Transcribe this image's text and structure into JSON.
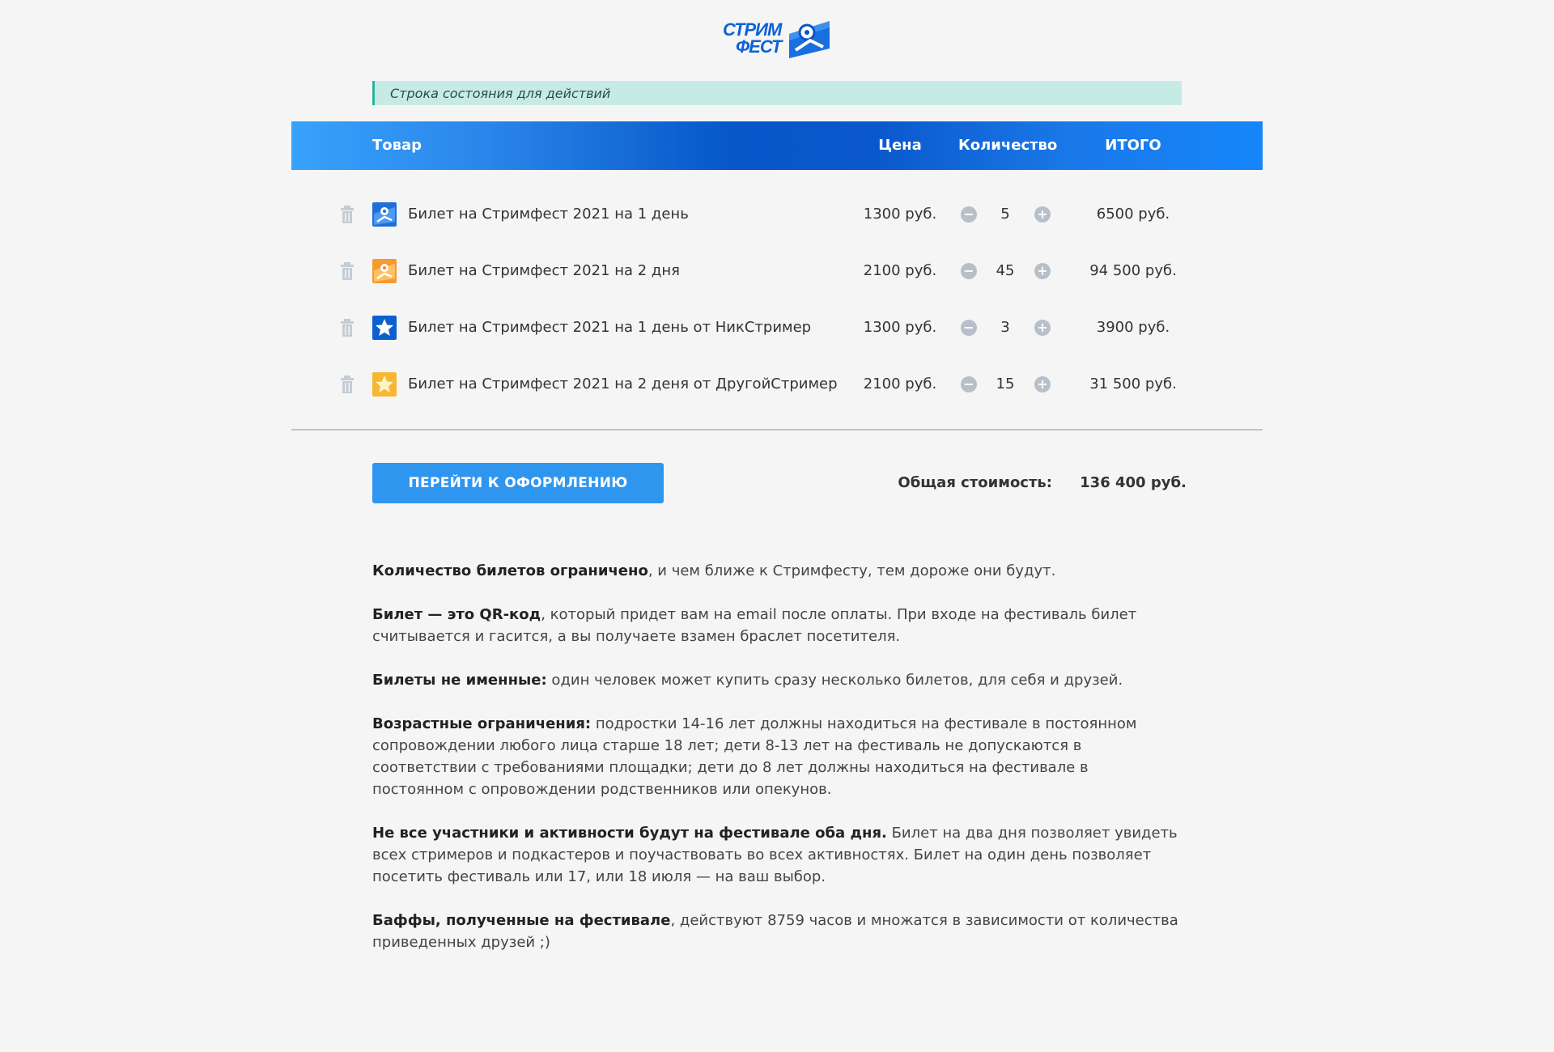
{
  "logo": {
    "line1": "СТРИМ",
    "line2": "ФЕСТ"
  },
  "status_bar": {
    "text": "Строка состояния для действий"
  },
  "table": {
    "headers": {
      "product": "Товар",
      "price": "Цена",
      "quantity": "Количество",
      "total": "ИТОГО"
    },
    "rows": [
      {
        "name": "Билет на Стримфест 2021 на 1 день",
        "price": "1300 руб.",
        "quantity": "5",
        "total": "6500 руб.",
        "icon": "blue-logo-ticket"
      },
      {
        "name": "Билет на Стримфест 2021 на 2 дня",
        "price": "2100 руб.",
        "quantity": "45",
        "total": "94 500 руб.",
        "icon": "orange-logo-ticket"
      },
      {
        "name": "Билет на Стримфест 2021 на 1 день от НикСтример",
        "price": "1300 руб.",
        "quantity": "3",
        "total": "3900 руб.",
        "icon": "blue-star"
      },
      {
        "name": "Билет на Стримфест 2021 на 2 деня от ДругойСтример",
        "price": "2100 руб.",
        "quantity": "15",
        "total": "31 500 руб.",
        "icon": "yellow-star"
      }
    ],
    "minus_icon": "minus-circle-icon",
    "plus_icon": "plus-circle-icon",
    "delete_icon": "trash-icon"
  },
  "checkout": {
    "button_label": "ПЕРЕЙТИ К ОФОРМЛЕНИЮ"
  },
  "summary": {
    "label": "Общая стоимость:",
    "value": "136 400 руб."
  },
  "notes": [
    {
      "bold": "Количество билетов ограничено",
      "text": ", и чем ближе к Стримфесту, тем дороже они будут."
    },
    {
      "bold": "Билет — это QR-код",
      "text": ", который придет вам на email после оплаты. При входе на фестиваль билет считывается и гасится, а вы получаете взамен браслет посетителя."
    },
    {
      "bold": "Билеты не именные:",
      "text": " один человек может купить сразу несколько билетов, для себя и друзей."
    },
    {
      "bold": "Возрастные ограничения:",
      "text": " подростки 14-16 лет должны находиться на фестивале в постоянном сопровождении любого лица старше 18 лет; дети 8-13 лет на фестиваль не допускаются в соответствии с требованиями площадки; дети до 8 лет должны находиться на фестивале в постоянном с опровождении родственников или опекунов."
    },
    {
      "bold": "Не все участники и активности будут на фестивале оба дня.",
      "text": " Билет на два дня позволяет увидеть всех стримеров и подкастеров и поучаствовать во всех активностях. Билет на один день позволяет посетить фестиваль или 17, или 18 июля — на ваш выбор."
    },
    {
      "bold": "Баффы, полученные на фестивале",
      "text": ", действуют 8759 часов и множатся в зависимости от количества приведенных друзей ;)"
    }
  ],
  "colors": {
    "header_gradient_start": "#37a2fb",
    "header_gradient_mid": "#0757c9",
    "status_bg": "#c6ebe4",
    "button_bg": "#2f96f0",
    "qty_button": "#b7c0c9"
  }
}
